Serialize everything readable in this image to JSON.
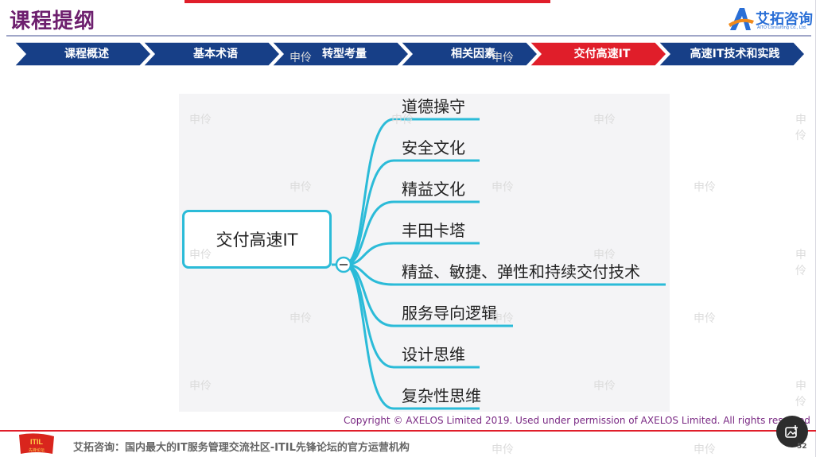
{
  "header": {
    "title": "课程提纲",
    "logo_text": "艾拓咨询",
    "logo_subtext": "AITO Consulting Co., Ltd."
  },
  "nav": {
    "items": [
      {
        "label": "课程概述",
        "active": false
      },
      {
        "label": "基本术语",
        "active": false
      },
      {
        "label": "转型考量",
        "active": false
      },
      {
        "label": "相关因素",
        "active": false
      },
      {
        "label": "交付高速IT",
        "active": true
      },
      {
        "label": "高速IT技术和实践",
        "active": false
      }
    ],
    "colors": {
      "normal": "#173f87",
      "active": "#e01e2a"
    }
  },
  "mindmap": {
    "root": "交付高速IT",
    "branches": [
      "道德操守",
      "安全文化",
      "精益文化",
      "丰田卡塔",
      "精益、敏捷、弹性和持续交付技术",
      "服务导向逻辑",
      "设计思维",
      "复杂性思维"
    ],
    "line_color": "#2bbbd8"
  },
  "watermark": "申伶",
  "copyright": "Copyright © AXELOS Limited 2019. Used under permission of AXELOS Limited. All rights reserved",
  "footer": {
    "logo_text": "ITIL",
    "logo_subtext": "先锋论坛",
    "text": "艾拓咨询：国内最大的IT服务管理交流社区-ITIL先锋论坛的官方运营机构",
    "page_number": "52"
  },
  "icons": {
    "gallery": "image-gallery-icon",
    "collapse": "collapse-minus-icon"
  }
}
